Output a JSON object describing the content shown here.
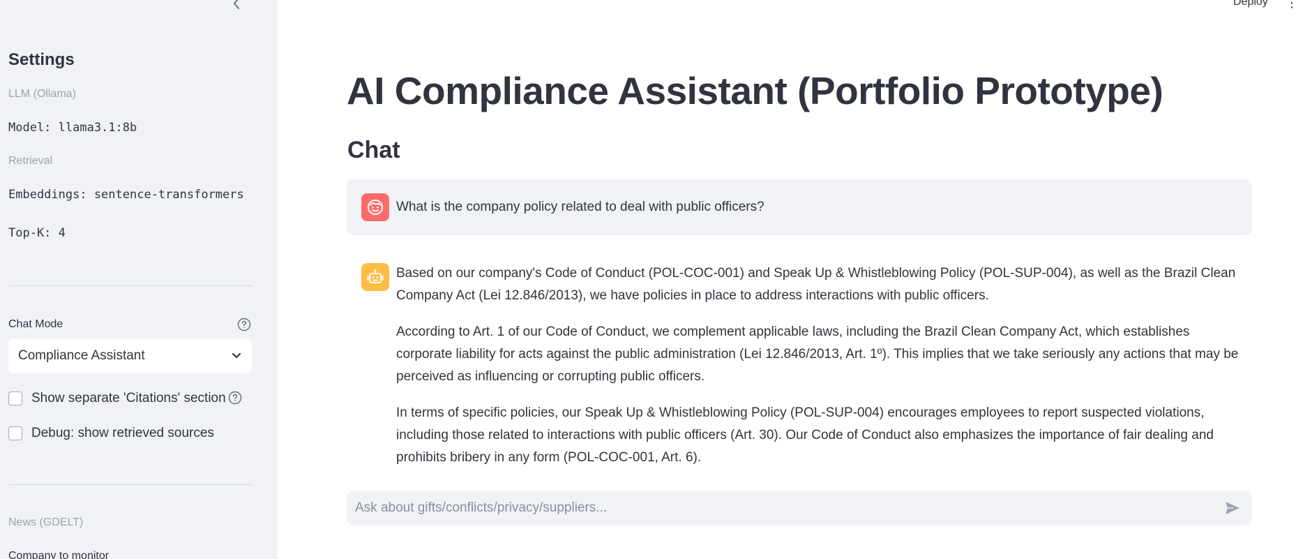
{
  "header": {
    "deploy_label": "Deploy",
    "menu_icon": "⋮"
  },
  "sidebar": {
    "title": "Settings",
    "llm_caption": "LLM (Ollama)",
    "model_text": "Model: llama3.1:8b",
    "retrieval_caption": "Retrieval",
    "embeddings_text": "Embeddings: sentence-transformers",
    "topk_text": "Top-K: 4",
    "chat_mode_label": "Chat Mode",
    "chat_mode_value": "Compliance Assistant",
    "citations_label": "Show separate 'Citations' section",
    "debug_label": "Debug: show retrieved sources",
    "news_caption": "News (GDELT)",
    "company_label": "Company to monitor"
  },
  "main": {
    "title": "AI Compliance Assistant (Portfolio Prototype)",
    "chat_heading": "Chat",
    "user_message": "What is the company policy related to deal with public officers?",
    "assistant_paragraphs": [
      "Based on our company's Code of Conduct (POL-COC-001) and Speak Up & Whistleblowing Policy (POL-SUP-004), as well as the Brazil Clean Company Act (Lei 12.846/2013), we have policies in place to address interactions with public officers.",
      "According to Art. 1 of our Code of Conduct, we complement applicable laws, including the Brazil Clean Company Act, which establishes corporate liability for acts against the public administration (Lei 12.846/2013, Art. 1º). This implies that we take seriously any actions that may be perceived as influencing or corrupting public officers.",
      "In terms of specific policies, our Speak Up & Whistleblowing Policy (POL-SUP-004) encourages employees to report suspected violations, including those related to interactions with public officers (Art. 30). Our Code of Conduct also emphasizes the importance of fair dealing and prohibits bribery in any form (POL-COC-001, Art. 6)."
    ],
    "input_placeholder": "Ask about gifts/conflicts/privacy/suppliers..."
  },
  "colors": {
    "sidebar_bg": "#f0f2f6",
    "user_avatar": "#ff6b6b",
    "bot_avatar": "#ffbd45",
    "text": "#31333f"
  },
  "icons": {
    "collapse": "chevron-left-icon",
    "help": "question-circle-icon",
    "dropdown": "chevron-down-icon",
    "user_avatar": "user-face-icon",
    "bot_avatar": "robot-icon",
    "send": "send-icon"
  }
}
